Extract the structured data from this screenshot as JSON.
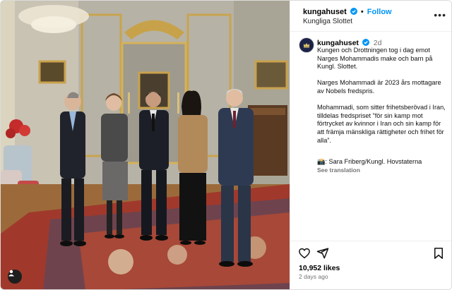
{
  "photo": {
    "alt_icon": "person-icon"
  },
  "header": {
    "username": "kungahuset",
    "separator": "•",
    "follow_label": "Follow",
    "location": "Kungliga Slottet",
    "more_icon": "more-options-icon"
  },
  "caption": {
    "username": "kungahuset",
    "time": "2d",
    "body": "Kungen och Drottningen tog i dag emot Narges Mohammadis make och barn på Kungl. Slottet.\n\nNarges Mohammadi är 2023 års mottagare av Nobels fredspris.\n\nMohammadi, som sitter frihetsberövad i Iran, tilldelas fredspriset ”för sin kamp mot förtrycket av kvinnor i Iran och sin kamp för att främja mänskliga rättigheter och frihet för alla”.",
    "credit": "📸: Sara Friberg/Kungl. Hovstaterna",
    "see_translation": "See translation"
  },
  "actions": {
    "likes": "10,952 likes",
    "time_ago": "2 days ago",
    "icons": [
      "heart-icon",
      "share-icon",
      "bookmark-icon"
    ]
  },
  "colors": {
    "follow_blue": "#0095f6",
    "verified_blue": "#0095f6",
    "secondary_text": "#737373"
  }
}
